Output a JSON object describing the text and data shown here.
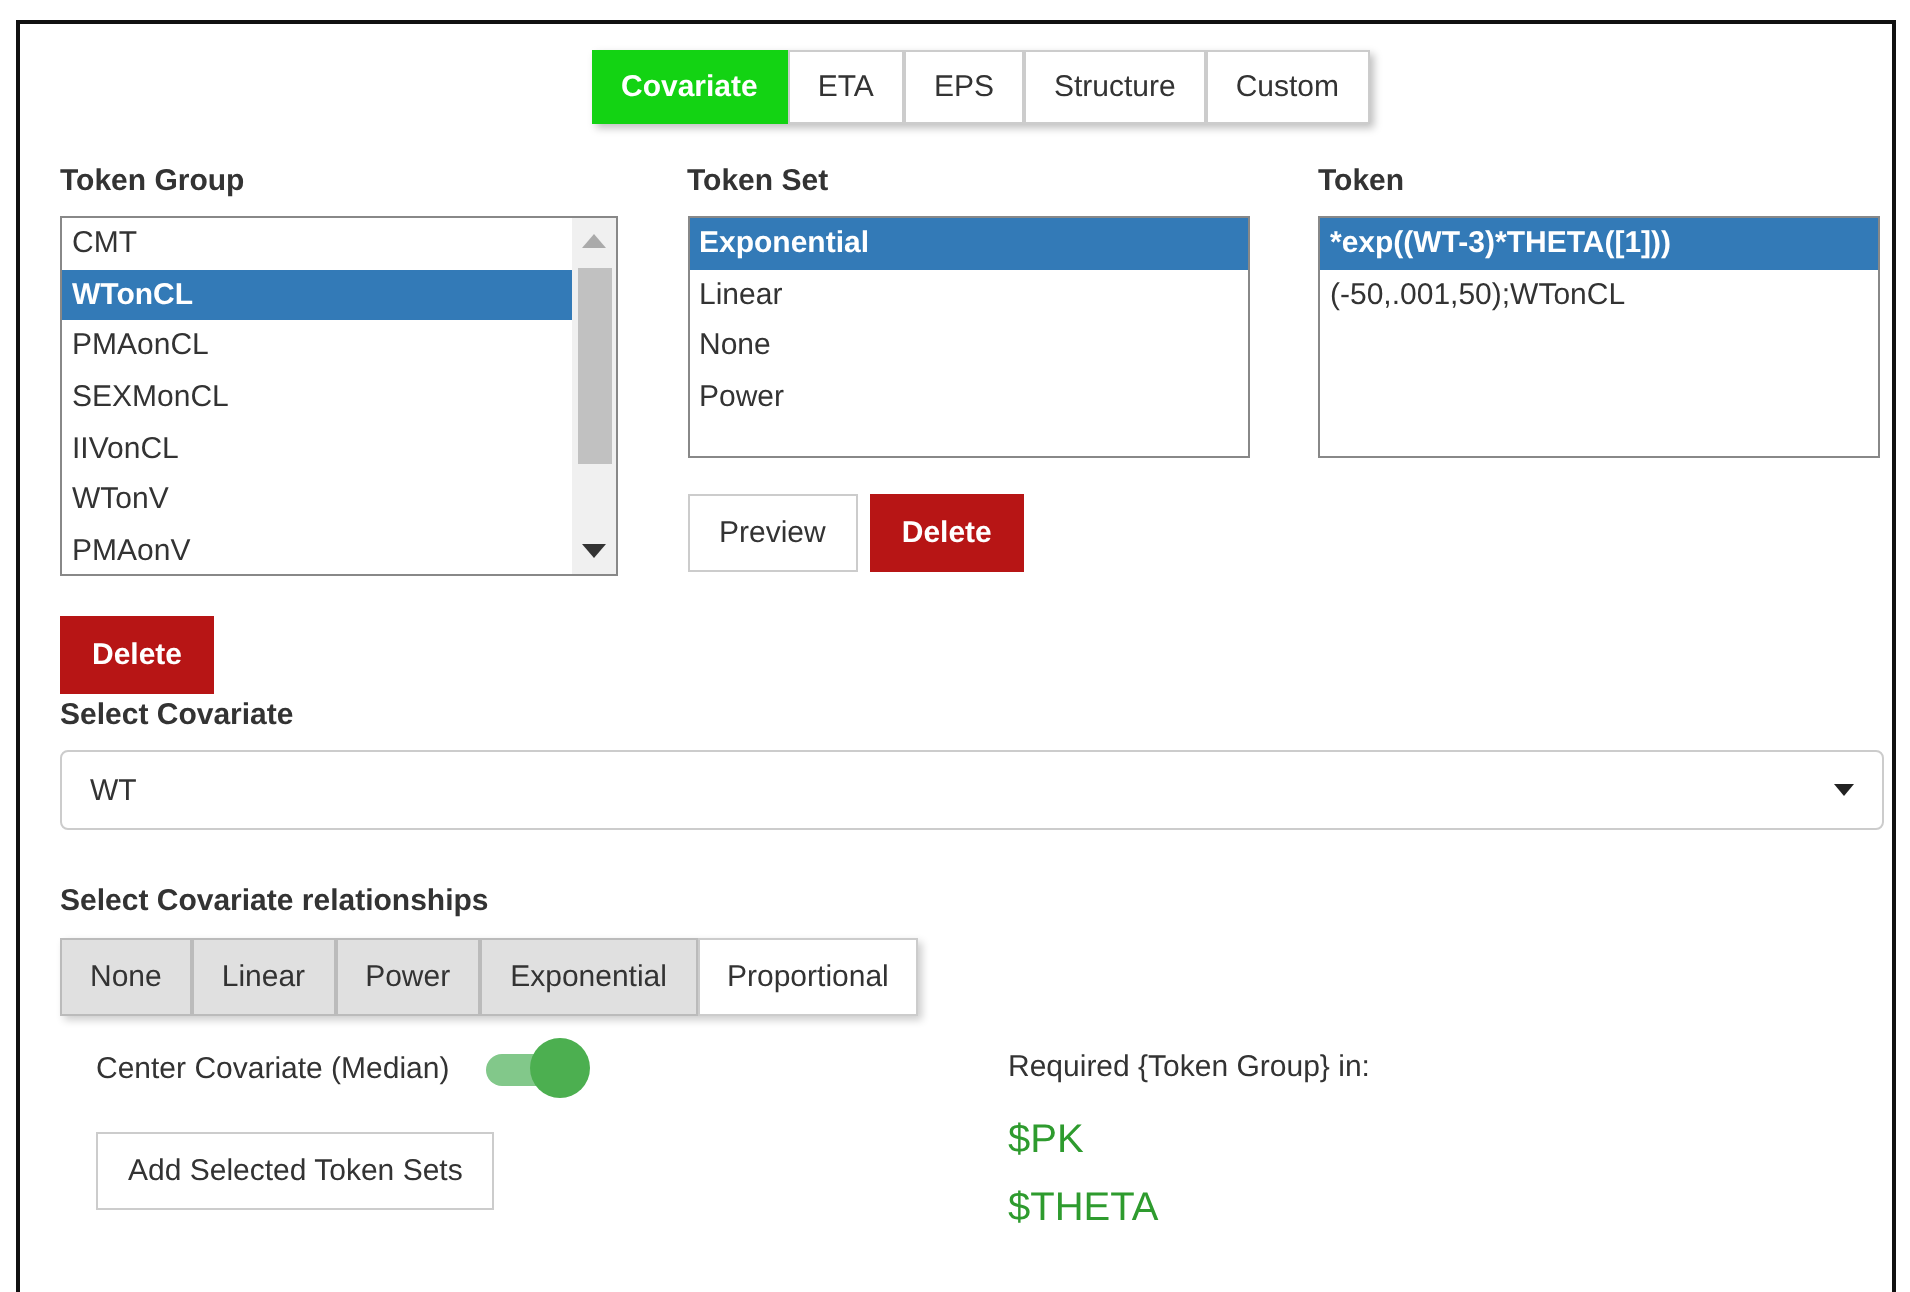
{
  "tabs": [
    {
      "label": "Covariate",
      "selected": true
    },
    {
      "label": "ETA",
      "selected": false
    },
    {
      "label": "EPS",
      "selected": false
    },
    {
      "label": "Structure",
      "selected": false
    },
    {
      "label": "Custom",
      "selected": false
    }
  ],
  "token_group": {
    "label": "Token Group",
    "items": [
      {
        "label": "CMT",
        "selected": false
      },
      {
        "label": "WTonCL",
        "selected": true
      },
      {
        "label": "PMAonCL",
        "selected": false
      },
      {
        "label": "SEXMonCL",
        "selected": false
      },
      {
        "label": "IIVonCL",
        "selected": false
      },
      {
        "label": "WTonV",
        "selected": false
      },
      {
        "label": "PMAonV",
        "selected": false
      }
    ],
    "delete_button": "Delete"
  },
  "token_set": {
    "label": "Token Set",
    "items": [
      {
        "label": "Exponential",
        "selected": true
      },
      {
        "label": "Linear",
        "selected": false
      },
      {
        "label": "None",
        "selected": false
      },
      {
        "label": "Power",
        "selected": false
      }
    ],
    "preview_button": "Preview",
    "delete_button": "Delete"
  },
  "token": {
    "label": "Token",
    "items": [
      {
        "label": "*exp((WT-3)*THETA([1]))",
        "selected": true
      },
      {
        "label": "(-50,.001,50);WTonCL",
        "selected": false
      }
    ]
  },
  "select_covariate": {
    "label": "Select Covariate",
    "value": "WT"
  },
  "relationships": {
    "label": "Select Covariate relationships",
    "options": [
      {
        "label": "None",
        "selected": true
      },
      {
        "label": "Linear",
        "selected": true
      },
      {
        "label": "Power",
        "selected": true
      },
      {
        "label": "Exponential",
        "selected": true
      },
      {
        "label": "Proportional",
        "selected": false
      }
    ]
  },
  "center_covariate": {
    "label": "Center Covariate (Median)",
    "on": true
  },
  "add_button": "Add Selected Token Sets",
  "required": {
    "label": "Required {Token Group} in:",
    "blocks": [
      "$PK",
      "$THETA"
    ]
  }
}
